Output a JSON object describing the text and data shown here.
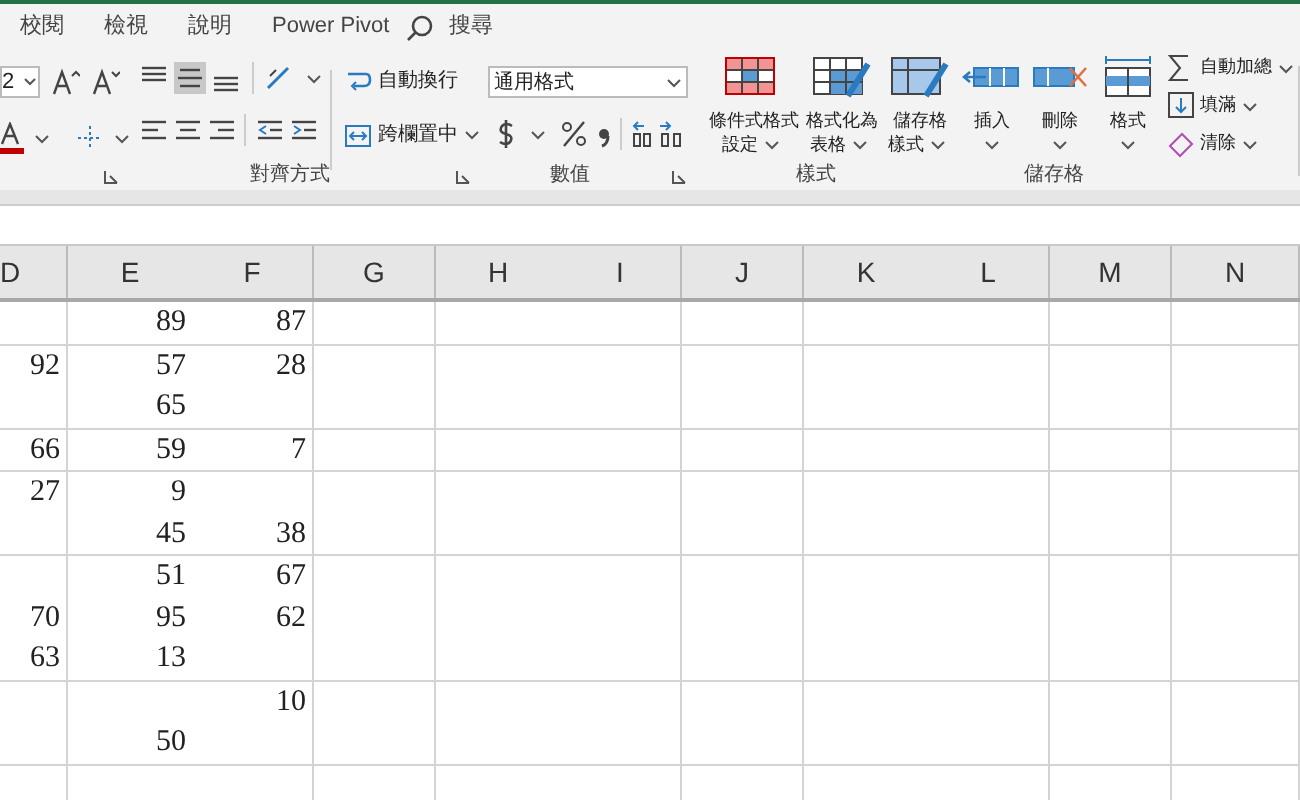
{
  "tabs": [
    {
      "label": "校閱"
    },
    {
      "label": "檢視"
    },
    {
      "label": "說明"
    },
    {
      "label": "Power Pivot"
    }
  ],
  "search": {
    "placeholder": "搜尋"
  },
  "font": {
    "size": "2"
  },
  "vertical_align": [
    {
      "selected": false
    },
    {
      "selected": true
    },
    {
      "selected": false
    }
  ],
  "wrap_text": "自動換行",
  "merge_center": "跨欄置中",
  "number_format": "通用格式",
  "style_buttons": [
    {
      "line1": "條件式格式",
      "line2": "設定"
    },
    {
      "line1": "格式化為",
      "line2": "表格"
    },
    {
      "line1": "儲存格",
      "line2": "樣式"
    }
  ],
  "cell_buttons": [
    {
      "label": "插入"
    },
    {
      "label": "刪除"
    },
    {
      "label": "格式"
    }
  ],
  "editing": [
    {
      "label": "自動加總"
    },
    {
      "label": "填滿"
    },
    {
      "label": "清除"
    }
  ],
  "group_labels": [
    "對齊方式",
    "數值",
    "樣式",
    "儲存格"
  ],
  "columns": [
    "D",
    "E",
    "F",
    "G",
    "H",
    "I",
    "J",
    "K",
    "L",
    "M",
    "N"
  ],
  "rows": [
    {
      "lines": [
        {
          "E": "89",
          "F": "87"
        }
      ]
    },
    {
      "lines": [
        {
          "D": "92",
          "E": "57",
          "F": "28"
        },
        {
          "E": "65"
        }
      ]
    },
    {
      "lines": [
        {
          "D": "66",
          "E": "59",
          "F": "7"
        }
      ]
    },
    {
      "lines": [
        {
          "D": "27",
          "E": "9"
        },
        {
          "E": "45",
          "F": "38"
        }
      ]
    },
    {
      "lines": [
        {
          "E": "51",
          "F": "67"
        },
        {
          "D": "70",
          "E": "95",
          "F": "62"
        },
        {
          "D": "63",
          "E": "13"
        }
      ]
    },
    {
      "lines": [
        {
          "F": "10"
        },
        {
          "E": "50"
        }
      ]
    }
  ]
}
